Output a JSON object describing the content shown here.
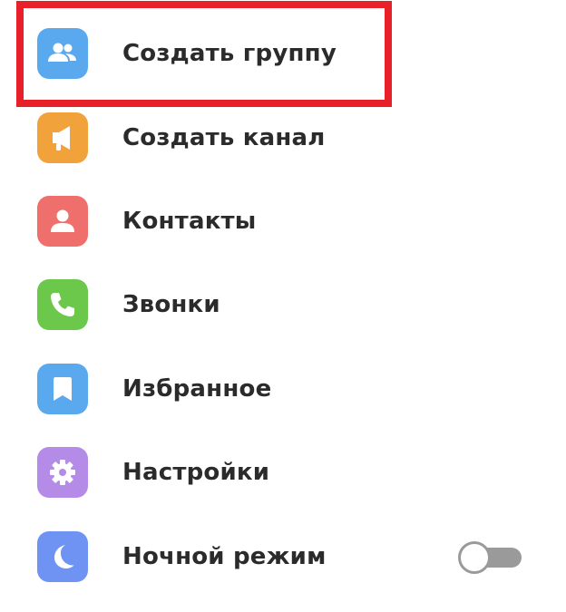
{
  "menu": {
    "items": [
      {
        "label": "Создать группу",
        "icon": "group-icon",
        "color": "#5aa9ee"
      },
      {
        "label": "Создать канал",
        "icon": "megaphone-icon",
        "color": "#f2a23a"
      },
      {
        "label": "Контакты",
        "icon": "person-icon",
        "color": "#ef6f6c"
      },
      {
        "label": "Звонки",
        "icon": "phone-icon",
        "color": "#6cc84a"
      },
      {
        "label": "Избранное",
        "icon": "bookmark-icon",
        "color": "#5aa9ee"
      },
      {
        "label": "Настройки",
        "icon": "gear-icon",
        "color": "#b48be6"
      },
      {
        "label": "Ночной режим",
        "icon": "moon-icon",
        "color": "#6e93f2"
      }
    ],
    "night_mode_enabled": false,
    "highlight_color": "#e8202a"
  }
}
